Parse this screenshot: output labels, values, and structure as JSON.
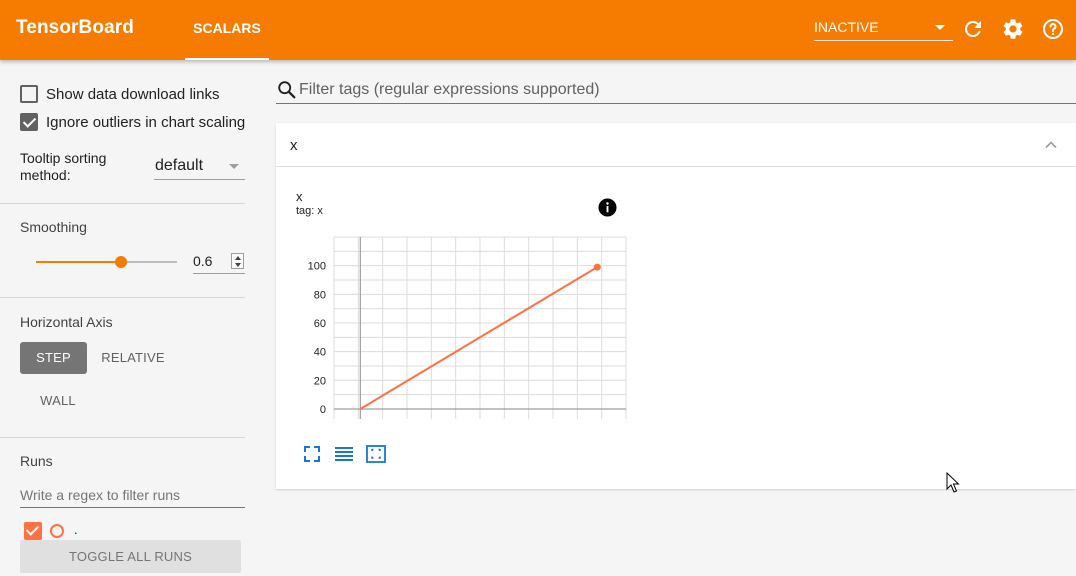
{
  "header": {
    "brand": "TensorBoard",
    "tab_label": "SCALARS",
    "status": "INACTIVE",
    "icons": [
      "reload-icon",
      "settings-icon",
      "help-icon"
    ]
  },
  "sidebar": {
    "show_download_links": "Show data download links",
    "ignore_outliers": "Ignore outliers in chart scaling",
    "tooltip_label": "Tooltip sorting method:",
    "tooltip_value": "default",
    "smoothing_title": "Smoothing",
    "smoothing_value": "0.6",
    "smoothing_fraction": 0.6,
    "axis_title": "Horizontal Axis",
    "axis_options": [
      "STEP",
      "RELATIVE",
      "WALL"
    ],
    "runs_title": "Runs",
    "runs_placeholder": "Write a regex to filter runs",
    "run_name": ".",
    "toggle_all": "TOGGLE ALL RUNS"
  },
  "main": {
    "filter_placeholder": "Filter tags (regular expressions supported)",
    "card_title": "x",
    "plot_title": "x",
    "plot_tag": "tag: x"
  },
  "colors": {
    "accent": "#f57c00",
    "run": "#ff7043",
    "tool": "#1976d2"
  },
  "chart_data": {
    "type": "line",
    "series": [
      {
        "x": [
          0,
          99
        ],
        "values": [
          0,
          99
        ]
      }
    ],
    "yticks": [
      0,
      20,
      40,
      60,
      80,
      100
    ],
    "ylim": [
      -7,
      120
    ],
    "xlim": [
      -11,
      111
    ],
    "grid": true
  }
}
